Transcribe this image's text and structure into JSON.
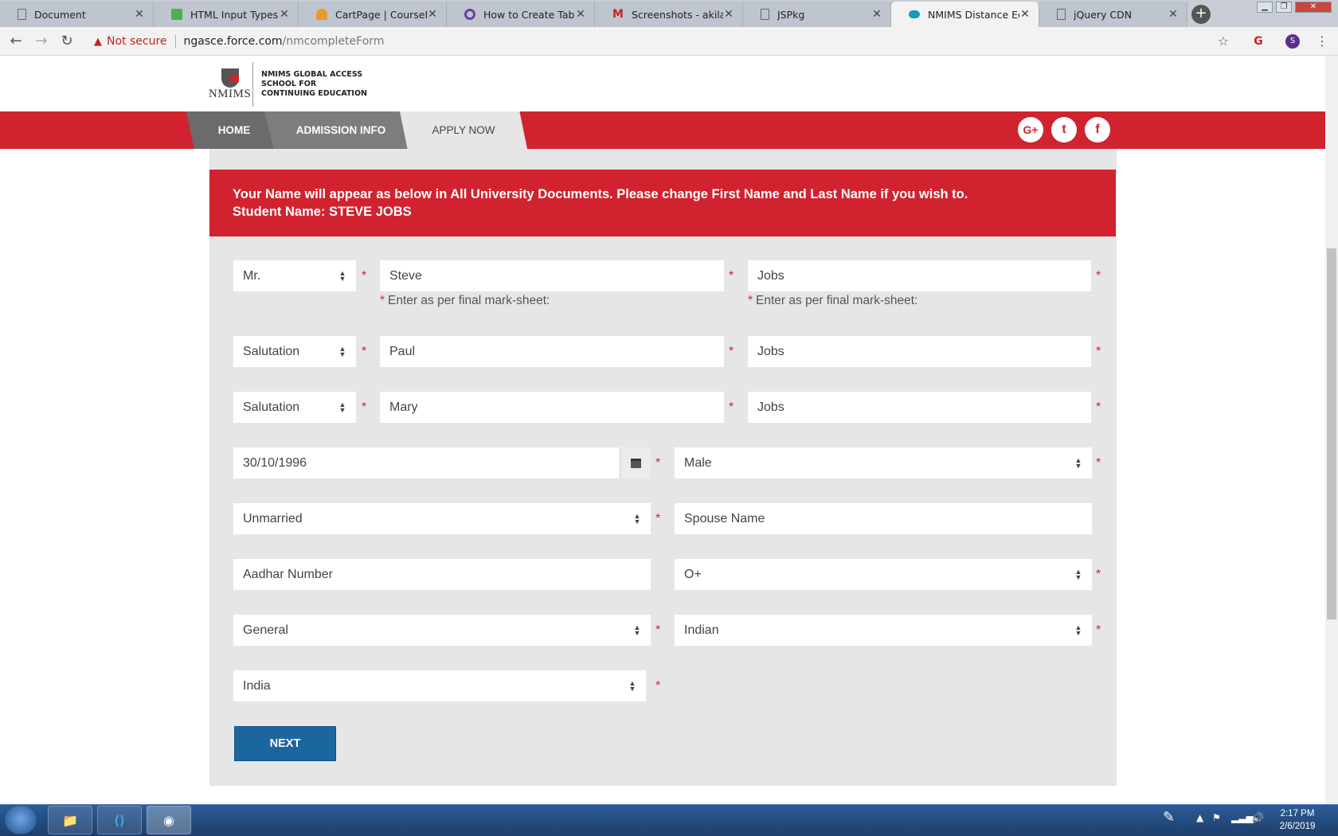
{
  "browser": {
    "tabs": [
      {
        "title": "Document",
        "icon": "document-icon",
        "active": false
      },
      {
        "title": "HTML Input Types",
        "icon": "w3schools-icon",
        "active": false
      },
      {
        "title": "CartPage | CourseBroth",
        "icon": "cart-icon",
        "active": false
      },
      {
        "title": "How to Create Tabbed",
        "icon": "link-icon",
        "active": false
      },
      {
        "title": "Screenshots - akilahme",
        "icon": "gmail-icon",
        "active": false
      },
      {
        "title": "JSPkg",
        "icon": "document-icon",
        "active": false
      },
      {
        "title": "NMIMS Distance Educ",
        "icon": "salesforce-icon",
        "active": true
      },
      {
        "title": "jQuery CDN",
        "icon": "document-icon",
        "active": false
      }
    ],
    "security_text": "Not secure",
    "url_host": "ngasce.force.com",
    "url_path": "/nmcompleteForm",
    "profile_initial": "S"
  },
  "header": {
    "logo_text": "NMIMS",
    "school_lines": [
      "NMIMS GLOBAL ACCESS",
      "SCHOOL FOR",
      "CONTINUING EDUCATION"
    ]
  },
  "nav": {
    "items": [
      "HOME",
      "ADMISSION INFO",
      "APPLY NOW"
    ],
    "social": [
      {
        "icon": "google-plus-icon",
        "glyph": "G+"
      },
      {
        "icon": "twitter-icon",
        "glyph": "t"
      },
      {
        "icon": "facebook-icon",
        "glyph": "f"
      }
    ]
  },
  "notice": {
    "line1": "Your Name will appear as below in All University Documents. Please change First Name and Last Name if you wish to.",
    "line2": "Student Name: STEVE JOBS"
  },
  "form": {
    "row1": {
      "salutation": "Mr.",
      "first_name": "Steve",
      "last_name": "Jobs",
      "hint": "Enter as per final mark-sheet:"
    },
    "row2": {
      "salutation": "Salutation",
      "first_name": "Paul",
      "last_name": "Jobs"
    },
    "row3": {
      "salutation": "Salutation",
      "first_name": "Mary",
      "last_name": "Jobs"
    },
    "dob": "30/10/1996",
    "gender": "Male",
    "marital_status": "Unmarried",
    "spouse_placeholder": "Spouse Name",
    "aadhar_placeholder": "Aadhar Number",
    "blood_group": "O+",
    "category": "General",
    "nationality": "Indian",
    "country": "India",
    "next_label": "NEXT",
    "required_mark": "*"
  },
  "taskbar": {
    "time": "2:17 PM",
    "date": "2/6/2019"
  },
  "colors": {
    "brand_red": "#d0232f",
    "button_blue": "#1c66a0",
    "panel_gray": "#e6e6e6"
  }
}
